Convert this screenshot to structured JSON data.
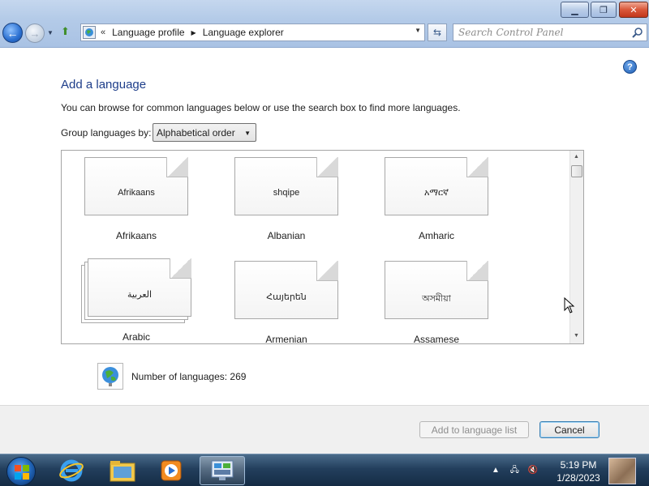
{
  "window": {
    "minimize_icon": "minimize-icon",
    "maximize_icon": "restore-icon",
    "close_icon": "close-icon"
  },
  "address_bar": {
    "overflow_chevron": "«",
    "breadcrumbs": [
      "Language profile",
      "Language explorer"
    ],
    "search_placeholder": "Search Control Panel"
  },
  "main": {
    "title": "Add a language",
    "description": "You can browse for common languages below or use the search box to find more languages.",
    "group_label": "Group languages by:",
    "group_selected": "Alphabetical order",
    "languages": [
      {
        "native": "Afrikaans",
        "name": "Afrikaans"
      },
      {
        "native": "shqipe",
        "name": "Albanian"
      },
      {
        "native": "አማርኛ",
        "name": "Amharic"
      },
      {
        "native": "العربية",
        "name": "Arabic"
      },
      {
        "native": "Հայերեն",
        "name": "Armenian"
      },
      {
        "native": "অসমীয়া",
        "name": "Assamese"
      }
    ],
    "count_label": "Number of languages: 269"
  },
  "footer": {
    "add_button": "Add to language list",
    "cancel_button": "Cancel"
  },
  "taskbar": {
    "apps": [
      "internet-explorer-icon",
      "file-explorer-icon",
      "media-player-icon",
      "control-panel-icon"
    ],
    "time": "5:19 PM",
    "date": "1/28/2023"
  },
  "colors": {
    "title_blue": "#1e3e8a",
    "taskbar": "#233f5d"
  }
}
